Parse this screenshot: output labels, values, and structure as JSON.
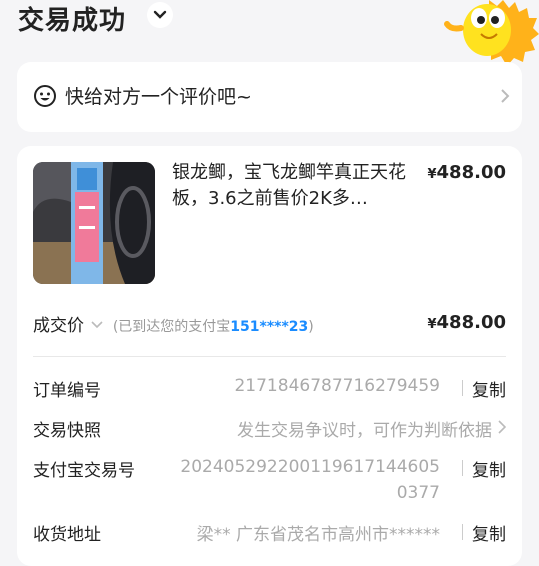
{
  "header": {
    "title": "交易成功"
  },
  "review": {
    "text": "快给对方一个评价吧~"
  },
  "product": {
    "title": "银龙鲫，宝飞龙鲫竿真正天花板，3.6之前售价2K多…",
    "yen": "¥",
    "price": "488.00"
  },
  "deal": {
    "label": "成交价",
    "note_prefix": "(已到达您的支付宝",
    "phone": "151****23",
    "note_suffix": ")",
    "yen": "¥",
    "price": "488.00"
  },
  "details": {
    "order_no": {
      "label": "订单编号",
      "value": "2171846787716279459",
      "action": "复制"
    },
    "snapshot": {
      "label": "交易快照",
      "value": "发生交易争议时，可作为判断依据"
    },
    "alipay_no": {
      "label": "支付宝交易号",
      "value_line1": "20240529220011961714460​5",
      "value_line2": "0377",
      "action": "复制"
    },
    "address": {
      "label": "收货地址",
      "value": "梁** 广东省茂名市高州市******",
      "action": "复制"
    }
  }
}
